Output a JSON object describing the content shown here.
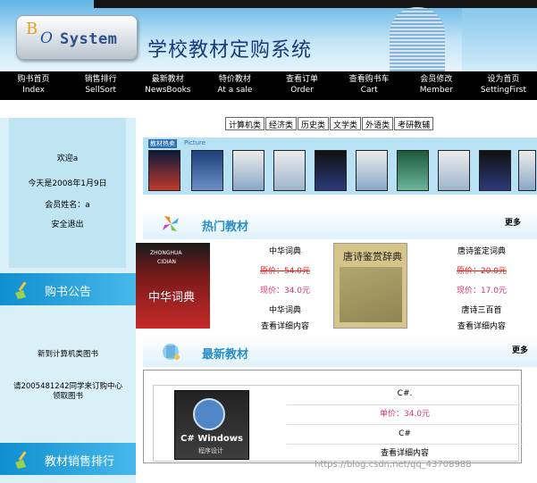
{
  "header": {
    "logo_b": "B",
    "logo_o": "O",
    "logo_system": "System",
    "site_title": "学校教材定购系统"
  },
  "nav": [
    {
      "zh": "购书首页",
      "en": "Index"
    },
    {
      "zh": "销售排行",
      "en": "SellSort"
    },
    {
      "zh": "最新教材",
      "en": "NewsBooks"
    },
    {
      "zh": "特价教材",
      "en": "At a sale"
    },
    {
      "zh": "查看订单",
      "en": "Order"
    },
    {
      "zh": "查看购书车",
      "en": "Cart"
    },
    {
      "zh": "会员修改",
      "en": "Member"
    },
    {
      "zh": "设为首页",
      "en": "SettingFirst"
    }
  ],
  "user": {
    "welcome": "欢迎a",
    "today": "今天是2008年1月9日",
    "member_name": "会员姓名：a",
    "logout": "安全退出"
  },
  "notice": {
    "title": "购书公告",
    "item1": "新到计算机类图书",
    "item2_line1": "请2005481242同学来订购中心",
    "item2_line2": "领取图书"
  },
  "sales_rank": {
    "title": "教材销售排行"
  },
  "categories": [
    "计算机类",
    "经济类",
    "历史类",
    "文学类",
    "外语类",
    "考研教辅"
  ],
  "picbar": {
    "tag": "教材热卖",
    "tag2": "Picture"
  },
  "hot": {
    "title": "热门教材",
    "more": "更多",
    "book1": {
      "name": "中华词典",
      "orig": "原价：54.0元",
      "now": "现价：34.0元",
      "name2": "中华词典",
      "detail": "查看详细内容"
    },
    "book2": {
      "name": "唐诗鉴定词典",
      "orig": "原价：20.0元",
      "now": "现价：17.0元",
      "name2": "唐诗三百首",
      "detail": "查看详细内容"
    },
    "book1_cover_top": "ZHONGHUA",
    "book1_cover_bot": "CIDIAN",
    "book1_cover_cn": "中华词典",
    "book2_cover_cn": "唐诗鉴赏辞典"
  },
  "newest": {
    "title": "最新教材",
    "more": "更多",
    "book_name": "C#.",
    "price": "单价：34.0元",
    "name2": "C#",
    "detail": "查看详细内容",
    "cover_text": "C# Windows",
    "cover_sub": "程序设计"
  },
  "watermark": "https://blog.csdn.net/qq_43708988",
  "colors": {
    "nav_bg": "#000000",
    "accent": "#2790c8",
    "price_now": "#d6336c",
    "price_orig": "#e02020"
  }
}
